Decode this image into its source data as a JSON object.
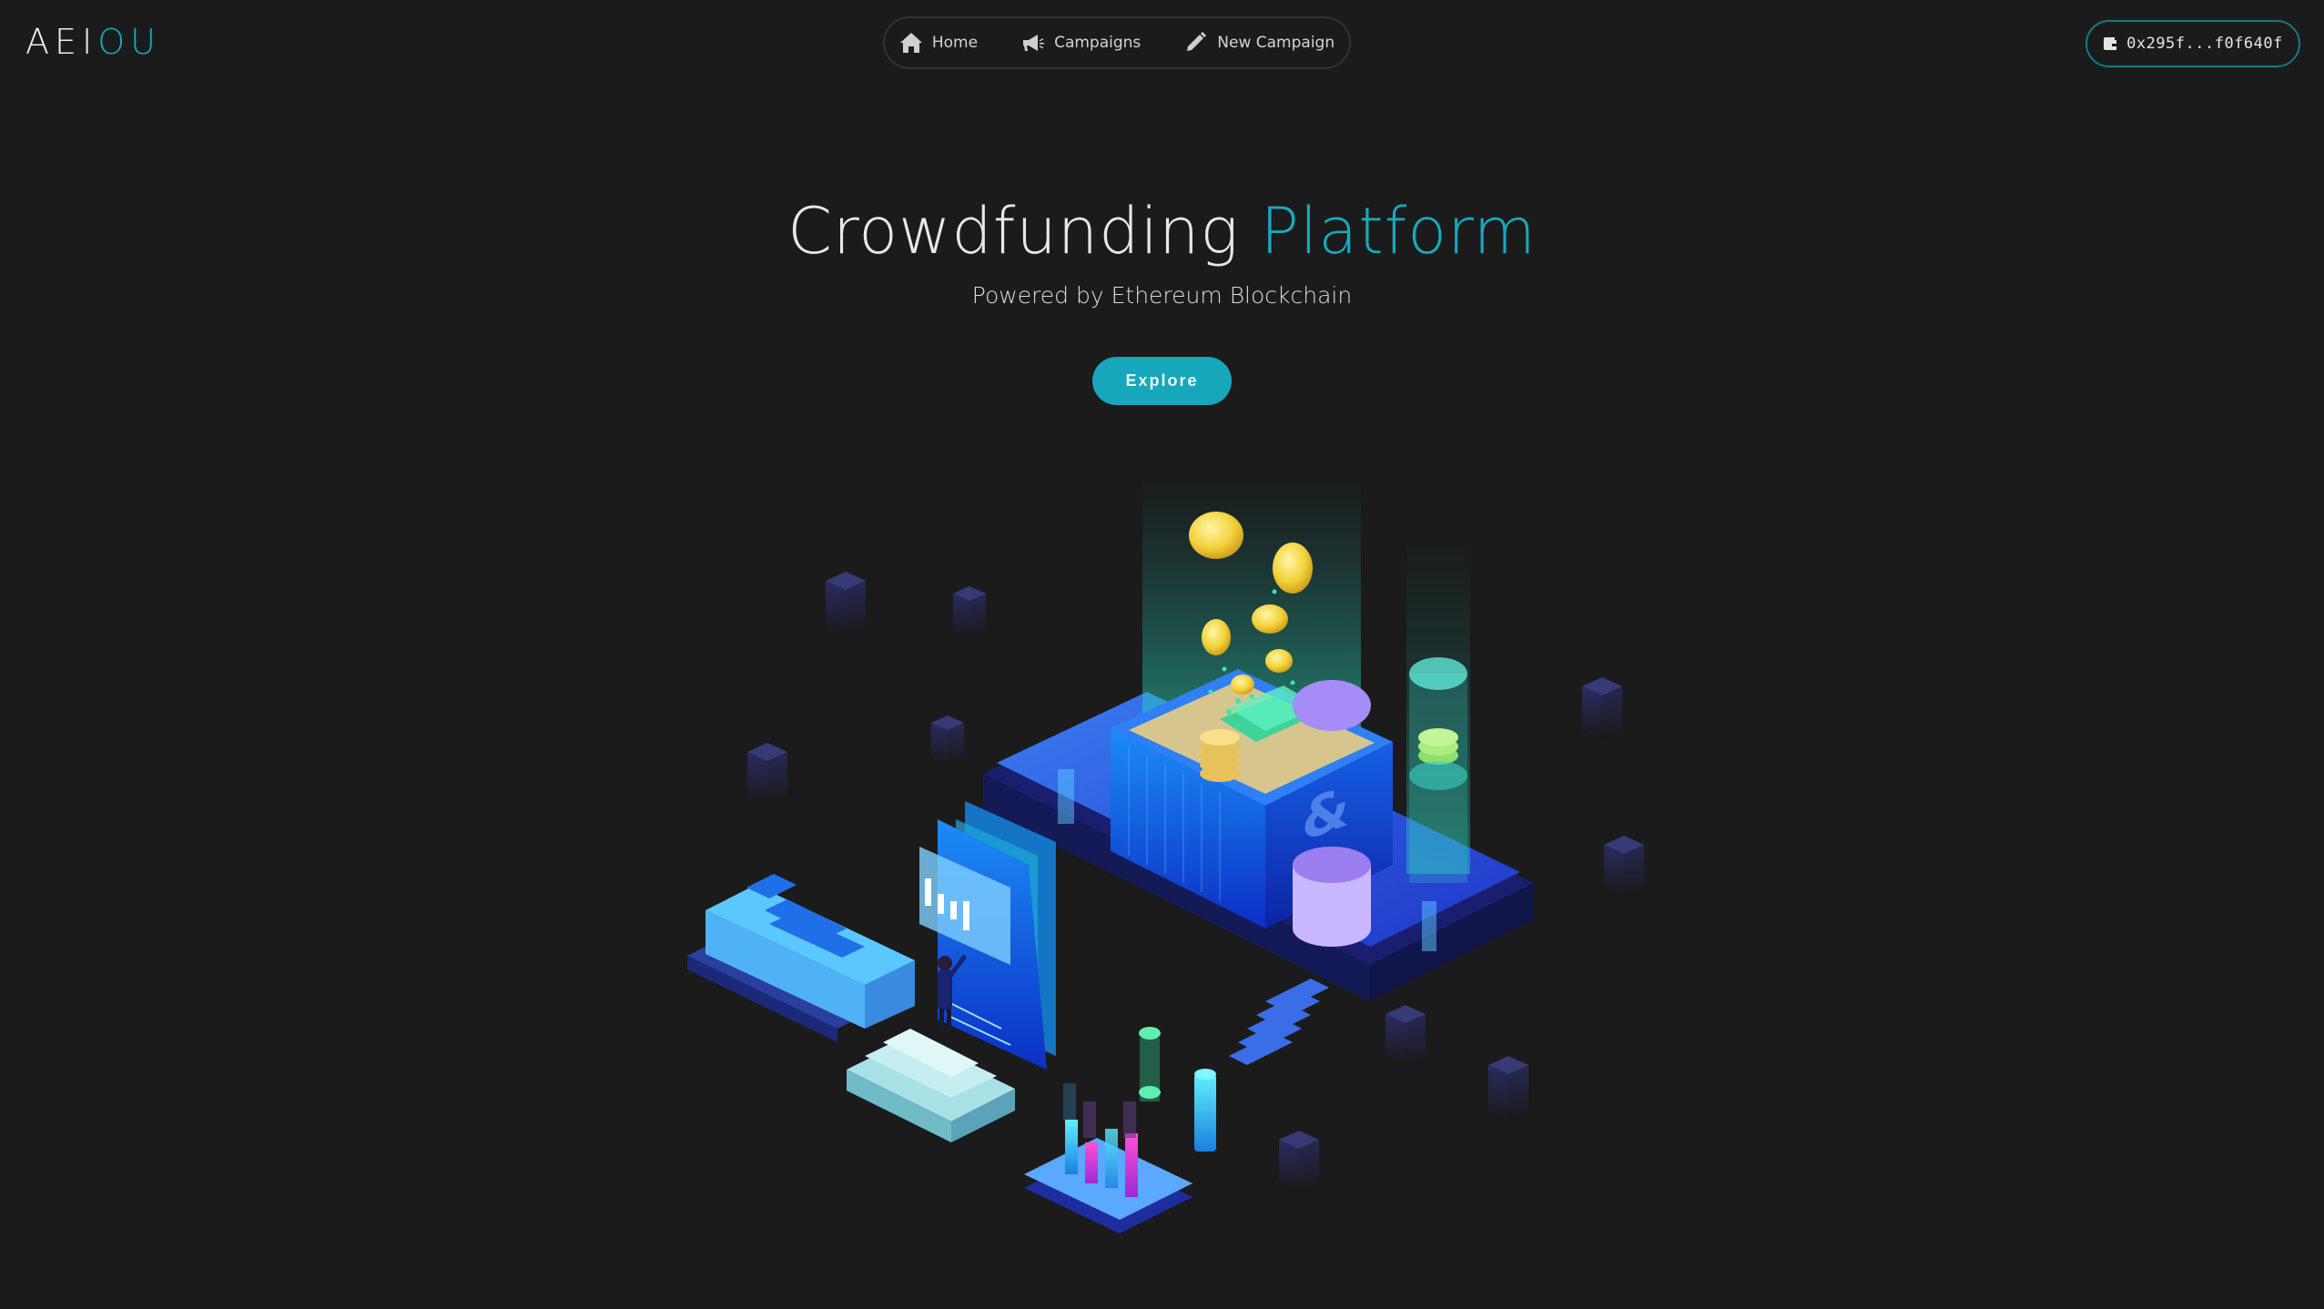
{
  "logo": {
    "part1": "AEI",
    "part2": "OU"
  },
  "nav": {
    "items": [
      {
        "label": "Home",
        "icon": "home-icon"
      },
      {
        "label": "Campaigns",
        "icon": "megaphone-icon"
      },
      {
        "label": "New Campaign",
        "icon": "pencil-icon"
      }
    ]
  },
  "wallet": {
    "address": "0x295f...f0f640f",
    "icon": "wallet-icon"
  },
  "hero": {
    "title_main": "Crowdfunding ",
    "title_accent": "Platform",
    "subtitle": "Powered by Ethereum Blockchain",
    "cta": "Explore"
  },
  "colors": {
    "background": "#1b1b1b",
    "accent": "#17a9bd",
    "text": "#e8e8e8"
  }
}
